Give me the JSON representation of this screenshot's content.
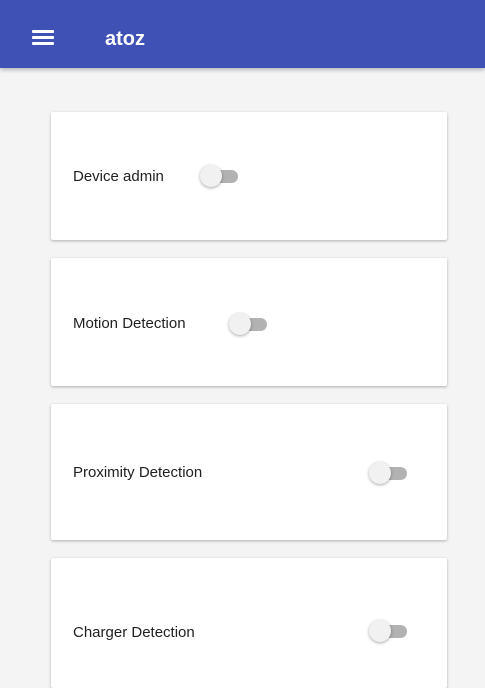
{
  "app_bar": {
    "title": "atoz",
    "menu_icon": "menu-icon",
    "color": "#3f51b5"
  },
  "settings": [
    {
      "label": "Device admin",
      "enabled": false
    },
    {
      "label": "Motion Detection",
      "enabled": false
    },
    {
      "label": "Proximity Detection",
      "enabled": false
    },
    {
      "label": "Charger Detection",
      "enabled": false
    }
  ]
}
